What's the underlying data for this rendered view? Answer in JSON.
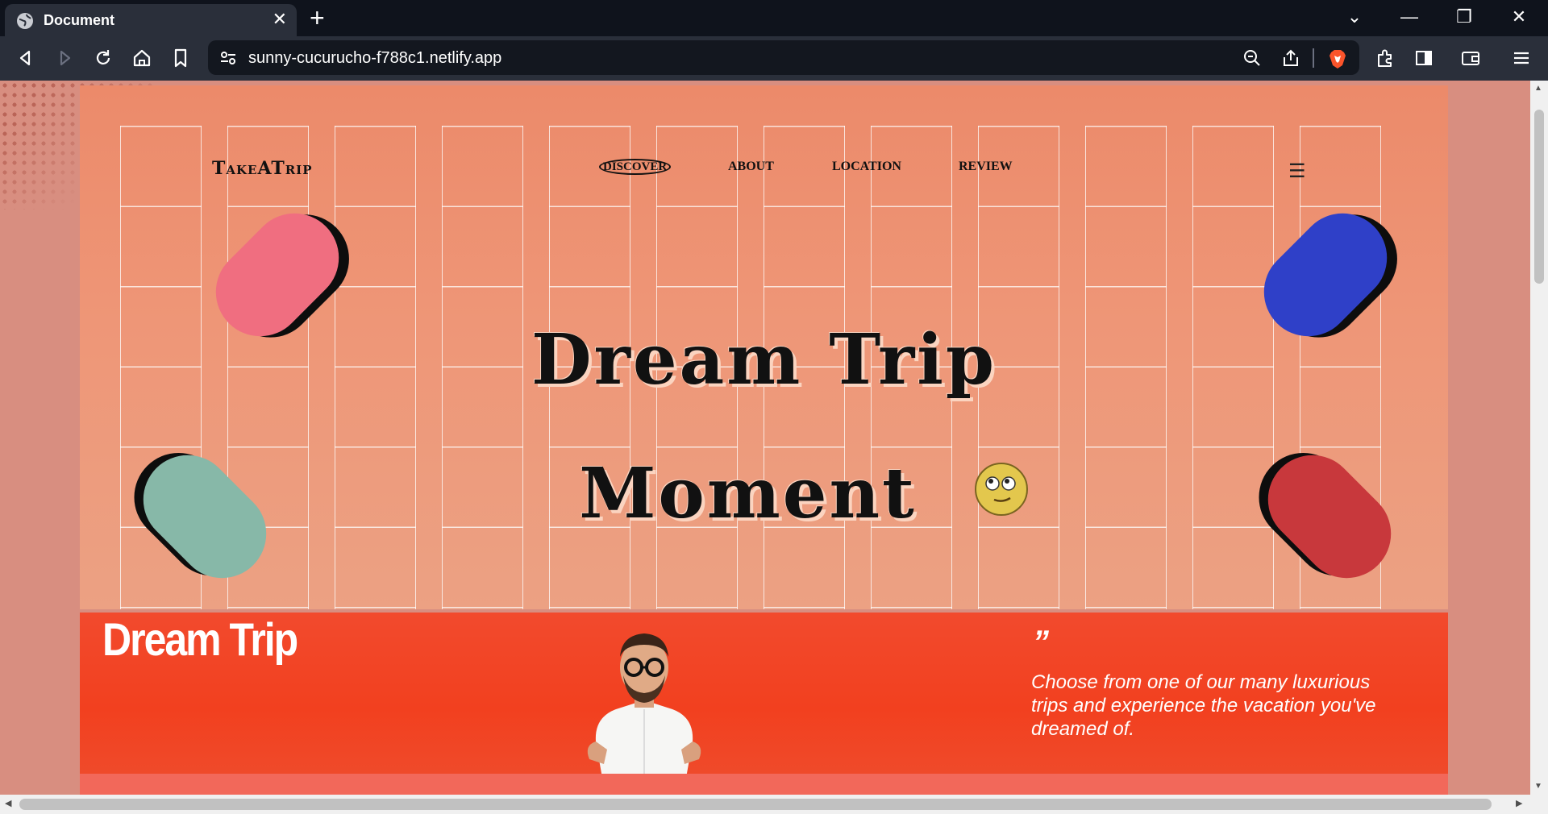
{
  "browser": {
    "tab_title": "Document",
    "tab_close": "✕",
    "new_tab": "+",
    "url": "sunny-cucurucho-f788c1.netlify.app",
    "window_controls": {
      "dropdown": "⌄",
      "minimize": "—",
      "restore": "❐",
      "close": "✕"
    }
  },
  "page": {
    "logo": "TakeATrip",
    "nav": {
      "discover": "DISCOVER",
      "about": "ABOUT",
      "location": "LOCATION",
      "review": "REVIEW"
    },
    "menu_icon": "☰",
    "headline_line1": "Dream Trip",
    "headline_line2": "Moment",
    "section": {
      "title": "Dream Trip",
      "quote_mark": "”",
      "quote": "Choose from one of our many luxurious trips and experience the vacation you've dreamed of."
    }
  },
  "colors": {
    "pill_pink": "#f06e80",
    "pill_blue": "#2f40c8",
    "pill_teal": "#87b8a8",
    "pill_red": "#c8383c",
    "red_section": "#f2401f"
  },
  "icons": [
    "globe-icon",
    "back-icon",
    "forward-icon",
    "reload-icon",
    "home-icon",
    "bookmark-icon",
    "site-info-icon",
    "zoom-icon",
    "share-icon",
    "brave-shield-icon",
    "extensions-icon",
    "sidebar-icon",
    "wallet-icon",
    "menu-icon"
  ]
}
